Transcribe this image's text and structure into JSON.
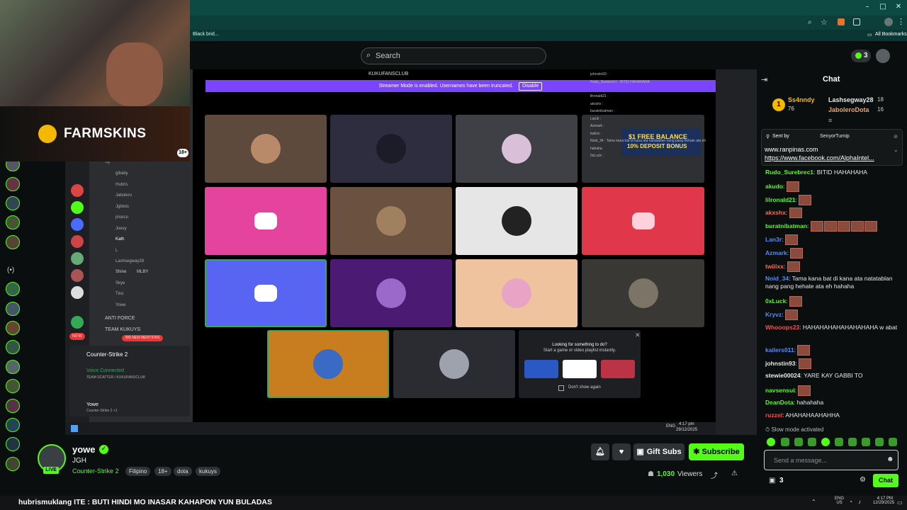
{
  "browser": {
    "bookmark_hint": "Black brid...",
    "all_bookmarks": "All Bookmarks"
  },
  "header": {
    "search_placeholder": "Search",
    "notif_count": "3"
  },
  "webcam": {
    "sponsor": "FARMSKINS",
    "sponsor_age": "18+"
  },
  "discord": {
    "server_title": "KUKUFANSCLUB",
    "streamer_banner": "Streamer Mode is enabled. Usernames have been truncated.",
    "disable": "Disable",
    "voice_members": [
      "Dj",
      "gibaby",
      "Hubris",
      "Jaboleru",
      "Jgblots",
      "jmarco",
      "Joevy",
      "Kath",
      "L",
      "Lashsegway28",
      "Shine",
      "Skye",
      "Tino",
      "Yowe"
    ],
    "mlby": "MLBY",
    "channels": [
      "ANTI FORCE",
      "TEAM KUKUYS"
    ],
    "new_mentions": "386 NEW MENTIONS",
    "new": "NEW",
    "activity": "Counter-Strike 2",
    "voice_connected": "Voice Connected",
    "voice_channel": "TEAM SCATTER / KUKUFANSCLUB",
    "user": "Yowe",
    "user_status": "Counter-Strike 2 +1",
    "overlay_title": "Looking for something to do?",
    "overlay_sub": "Start a game or video playlist instantly.",
    "dont_show": "Don't show again",
    "promo_line1": "$1 FREE BALANCE",
    "promo_line2": "10% DEPOSIT BONUS",
    "time": "4:17 pm",
    "date": "29/12/2025",
    "eng": "ENG",
    "mini_chat": [
      "johnstin93 :",
      "Rudo_Surebrec1 : BITID HAHAHAHA",
      "lilronald21 :",
      "akxshx :",
      "buratnibatman :",
      "Lan3r :",
      "Azmark :",
      "twiiixx :",
      "Noid_34 : Tama kana bat di kana ata natatablan nang pang hehate ata eh hahaha",
      "0xLuck :"
    ]
  },
  "stream": {
    "streamer": "yowe",
    "title": "JGH",
    "category": "Counter-Strike 2",
    "tags": [
      "Filipino",
      "18+",
      "dota",
      "kukuys"
    ],
    "live": "LIVE",
    "viewers_num": "1,030",
    "viewers_label": "Viewers",
    "gift_subs": "Gift Subs",
    "subscribe": "Subscribe"
  },
  "chat": {
    "title": "Chat",
    "leaderboard": [
      {
        "rank": "1",
        "name": "Ss4nndy",
        "count": "76"
      },
      {
        "name": "Lashsegway28",
        "count": "18"
      },
      {
        "name": "JaboleroDota",
        "count": "16"
      }
    ],
    "pinned_by": "Sent by",
    "pinned_user": "SenyorTurnip",
    "pinned_line1": "www.ranpinas.com",
    "pinned_line2": "https://www.facebook.com/AlphaIntel...",
    "messages": [
      {
        "user": "Rudo_Surebrec1",
        "text": "BITID HAHAHAHA",
        "color": "#53fc18",
        "emotes": 0
      },
      {
        "user": "akudo",
        "text": "",
        "color": "#53fc18",
        "emotes": 1
      },
      {
        "user": "lilronald21",
        "text": "",
        "color": "#53fc18",
        "emotes": 1
      },
      {
        "user": "akxshx",
        "text": "",
        "color": "#ff6b4a",
        "emotes": 1
      },
      {
        "user": "buratnibatman",
        "text": "",
        "color": "#53fc18",
        "emotes": 5
      },
      {
        "user": "Lan3r",
        "text": "",
        "color": "#4f8cff",
        "emotes": 1
      },
      {
        "user": "Azmark",
        "text": "",
        "color": "#4f8cff",
        "emotes": 1
      },
      {
        "user": "twiiixx",
        "text": "",
        "color": "#ff6b4a",
        "emotes": 1
      },
      {
        "user": "Noid_34",
        "text": "Tama kana bat di kana ata natatablan nang pang hehate ata eh hahaha",
        "color": "#4f8cff",
        "emotes": 0
      },
      {
        "user": "0xLuck",
        "text": "",
        "color": "#53fc18",
        "emotes": 1
      },
      {
        "user": "Kryvz",
        "text": "",
        "color": "#4f8cff",
        "emotes": 1
      },
      {
        "user": "Whooops23",
        "text": "HAHAHAHAHAHAHAHAHA w abat",
        "color": "#ff4a4a",
        "emotes": 0
      },
      {
        "user": "kailers011",
        "text": "",
        "color": "#4f8cff",
        "emotes": 1
      },
      {
        "user": "johnstin93",
        "text": "",
        "color": "#e7e9ea",
        "emotes": 1
      },
      {
        "user": "stewie00024",
        "text": "YARE KAY GABBI TO",
        "color": "#e7e9ea",
        "emotes": 0
      },
      {
        "user": "navsensui",
        "text": "",
        "color": "#53fc18",
        "emotes": 1
      },
      {
        "user": "DeanDota",
        "text": "hahahaha",
        "color": "#53fc18",
        "emotes": 0
      },
      {
        "user": "ruzzel",
        "text": "AHAHAHAAHAHHA",
        "color": "#ff4a4a",
        "emotes": 0
      }
    ],
    "slow_mode": "Slow mode activated",
    "input_placeholder": "Send a message...",
    "gift_count": "3",
    "chat_button": "Chat"
  },
  "ticker": {
    "text": "hubrismuklang ITE : BUTI HINDI MO INASAR KAHAPON YUN BULADAS",
    "lang": "ENG",
    "region": "US",
    "time": "4:17 PM",
    "date": "12/29/2025"
  }
}
